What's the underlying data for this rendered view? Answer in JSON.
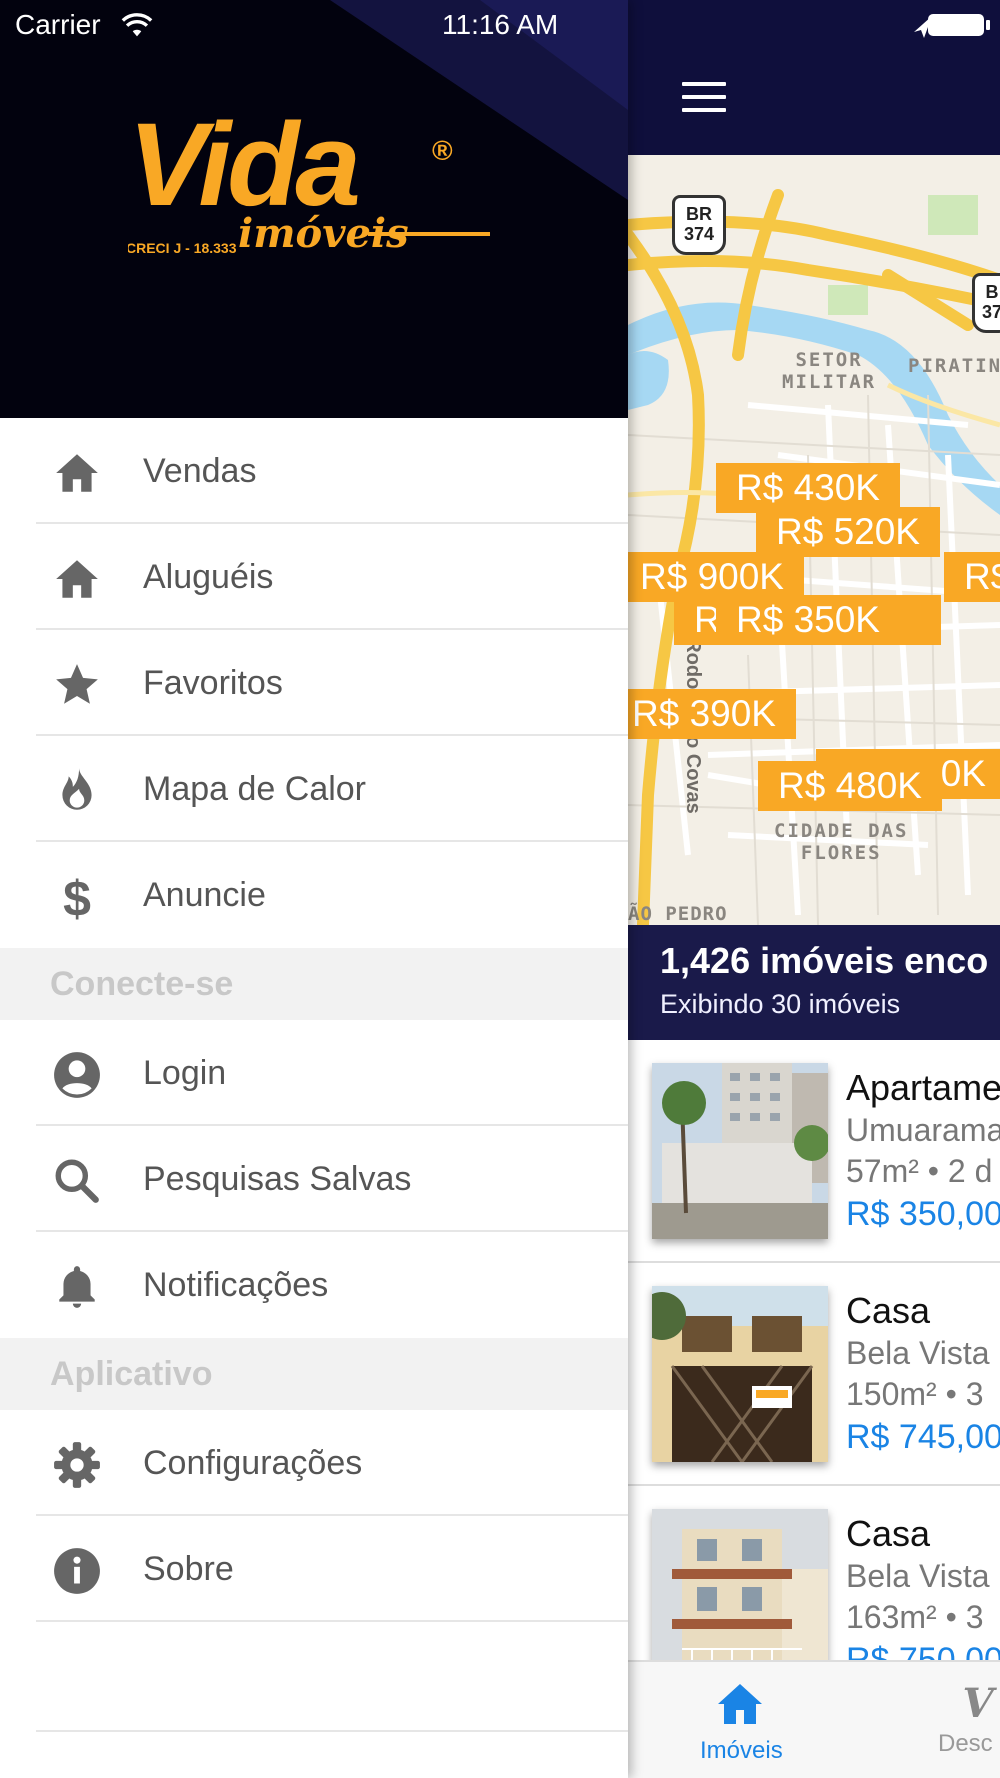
{
  "status_bar": {
    "carrier": "Carrier",
    "time": "11:16 AM"
  },
  "brand": {
    "name": "Vida",
    "registered": "®",
    "tagline": "imóveis",
    "creci": "CRECI J - 18.333",
    "accent_color": "#f9a825"
  },
  "menu": {
    "items": [
      {
        "label": "Vendas",
        "icon": "home-icon"
      },
      {
        "label": "Aluguéis",
        "icon": "home-icon"
      },
      {
        "label": "Favoritos",
        "icon": "star-icon"
      },
      {
        "label": "Mapa de Calor",
        "icon": "flame-icon"
      },
      {
        "label": "Anuncie",
        "icon": "dollar-icon"
      }
    ],
    "section_connect": "Conecte-se",
    "connect_items": [
      {
        "label": "Login",
        "icon": "account-icon"
      },
      {
        "label": "Pesquisas Salvas",
        "icon": "search-icon"
      },
      {
        "label": "Notificações",
        "icon": "bell-icon"
      }
    ],
    "section_app": "Aplicativo",
    "app_items": [
      {
        "label": "Configurações",
        "icon": "gear-icon"
      },
      {
        "label": "Sobre",
        "icon": "info-icon"
      }
    ]
  },
  "map": {
    "labels": {
      "setor_militar": "SETOR\nMILITAR",
      "piratin": "PIRATIN",
      "cidade_das_flores": "CIDADE DAS\nFLORES",
      "rodovia": "Rodo Mário Covas",
      "sao_pedro": "ÃO PEDRO",
      "br1": "BR\n374",
      "br2": "B\n37"
    },
    "pins": [
      "R$ 430K",
      "R$ 520K",
      "R$ 900K",
      "R$",
      "R$ 350K",
      "R$ 390K",
      "0K",
      "R$ 480K"
    ]
  },
  "results": {
    "title": "1,426 imóveis enco",
    "subtitle": "Exibindo 30 imóveis"
  },
  "listings": [
    {
      "type": "Apartame",
      "area": "Umuarama",
      "size": "57m² • 2 d",
      "price": "R$ 350,00"
    },
    {
      "type": "Casa",
      "area": "Bela Vista",
      "size": "150m² • 3",
      "price": "R$ 745,00"
    },
    {
      "type": "Casa",
      "area": "Bela Vista",
      "size": "163m² • 3",
      "price": "R$ 750,00"
    }
  ],
  "tabbar": {
    "tab1_label": "Imóveis",
    "tab2_label": "Desc",
    "active_color": "#1a84e5"
  }
}
